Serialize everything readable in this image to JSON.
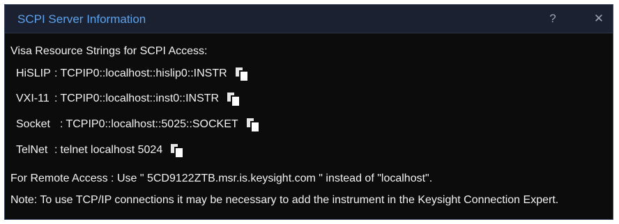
{
  "dialog": {
    "title": "SCPI Server Information",
    "help_label": "?",
    "close_label": "✕"
  },
  "content": {
    "heading": "Visa Resource Strings for SCPI Access:",
    "rows": [
      {
        "protocol": "HiSLIP",
        "separator": ":",
        "value": "TCPIP0::localhost::hislip0::INSTR",
        "icon": "copy-icon"
      },
      {
        "protocol": "VXI-11",
        "separator": ":",
        "value": "TCPIP0::localhost::inst0::INSTR",
        "icon": "copy-icon"
      },
      {
        "protocol": "Socket",
        "separator": ":",
        "value": "TCPIP0::localhost::5025::SOCKET",
        "icon": "copy-icon"
      },
      {
        "protocol": "TelNet",
        "separator": ":",
        "value": "telnet localhost 5024",
        "icon": "copy-icon"
      }
    ],
    "remote_access": "For Remote Access : Use \" 5CD9122ZTB.msr.is.keysight.com \" instead of \"localhost\".",
    "note": "Note: To use TCP/IP connections it may be necessary to add the instrument in the Keysight Connection Expert."
  },
  "colors": {
    "title_text": "#5da2ec",
    "background": "#0c0c0c",
    "titlebar": "#1b2130",
    "text": "#f2f2f2"
  }
}
